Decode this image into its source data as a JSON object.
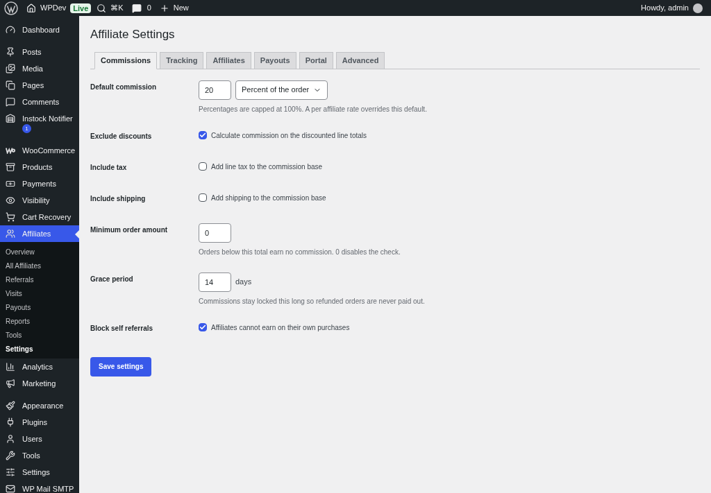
{
  "admin_bar": {
    "site": "WPDev",
    "live_badge": "Live",
    "shortcut": "⌘K",
    "comments_count": "0",
    "new_label": "New",
    "greeting": "Howdy, admin"
  },
  "sidebar": {
    "groups": [
      [
        {
          "label": "Dashboard",
          "selected": false
        }
      ],
      [
        {
          "label": "Posts",
          "selected": false
        },
        {
          "label": "Media",
          "selected": false
        },
        {
          "label": "Pages",
          "selected": false
        },
        {
          "label": "Comments",
          "selected": false
        },
        {
          "label": "Instock Notifier",
          "selected": false,
          "badge": "1"
        }
      ],
      [
        {
          "label": "WooCommerce",
          "selected": false
        },
        {
          "label": "Products",
          "selected": false
        },
        {
          "label": "Payments",
          "selected": false
        },
        {
          "label": "Visibility",
          "selected": false
        },
        {
          "label": "Cart Recovery",
          "selected": false
        },
        {
          "label": "Affiliates",
          "selected": true,
          "children": [
            {
              "label": "Overview",
              "selected": false
            },
            {
              "label": "All Affiliates",
              "selected": false
            },
            {
              "label": "Referrals",
              "selected": false
            },
            {
              "label": "Visits",
              "selected": false
            },
            {
              "label": "Payouts",
              "selected": false
            },
            {
              "label": "Reports",
              "selected": false
            },
            {
              "label": "Tools",
              "selected": false
            },
            {
              "label": "Settings",
              "selected": true
            }
          ]
        },
        {
          "label": "Analytics",
          "selected": false
        },
        {
          "label": "Marketing",
          "selected": false
        }
      ],
      [
        {
          "label": "Appearance",
          "selected": false
        },
        {
          "label": "Plugins",
          "selected": false
        },
        {
          "label": "Users",
          "selected": false
        },
        {
          "label": "Tools",
          "selected": false
        },
        {
          "label": "Settings",
          "selected": false
        },
        {
          "label": "WP Mail SMTP",
          "selected": false
        }
      ]
    ]
  },
  "page_title": "Affiliate Settings",
  "tabs": [
    {
      "label": "Commissions",
      "selected": true
    },
    {
      "label": "Tracking",
      "selected": false
    },
    {
      "label": "Affiliates",
      "selected": false
    },
    {
      "label": "Payouts",
      "selected": false
    },
    {
      "label": "Portal",
      "selected": false
    },
    {
      "label": "Advanced",
      "selected": false
    }
  ],
  "settings": [
    {
      "kind": "number_select",
      "label": "Default commission",
      "value": "20",
      "select_value": "Percent of the order",
      "description": "Percentages are capped at 100%. A per affiliate rate overrides this default."
    },
    {
      "kind": "checkbox",
      "label": "Exclude discounts",
      "checked": true,
      "text": "Calculate commission on the discounted line totals"
    },
    {
      "kind": "checkbox",
      "label": "Include tax",
      "checked": false,
      "text": "Add line tax to the commission base"
    },
    {
      "kind": "checkbox",
      "label": "Include shipping",
      "checked": false,
      "text": "Add shipping to the commission base"
    },
    {
      "kind": "number",
      "label": "Minimum order amount",
      "value": "0",
      "description": "Orders below this total earn no commission. 0 disables the check."
    },
    {
      "kind": "number",
      "label": "Grace period",
      "value": "14",
      "unit": "days",
      "description": "Commissions stay locked this long so refunded orders are never paid out."
    },
    {
      "kind": "checkbox",
      "label": "Block self referrals",
      "checked": true,
      "text": "Affiliates cannot earn on their own purchases"
    }
  ],
  "save_button": "Save settings"
}
